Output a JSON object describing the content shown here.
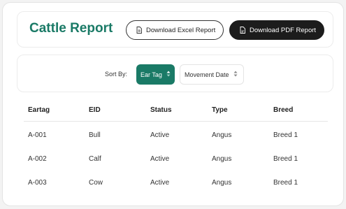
{
  "header": {
    "title": "Cattle Report",
    "excel_button": "Download Excel Report",
    "pdf_button": "Download PDF Report"
  },
  "sort": {
    "label": "Sort By:",
    "options": [
      {
        "label": "Ear Tag",
        "active": true
      },
      {
        "label": "Movement Date",
        "active": false
      }
    ]
  },
  "table": {
    "columns": [
      "Eartag",
      "EID",
      "Status",
      "Type",
      "Breed"
    ],
    "rows": [
      [
        "A-001",
        "Bull",
        "Active",
        "Angus",
        "Breed 1"
      ],
      [
        "A-002",
        "Calf",
        "Active",
        "Angus",
        "Breed 1"
      ],
      [
        "A-003",
        "Cow",
        "Active",
        "Angus",
        "Breed 1"
      ]
    ]
  },
  "colors": {
    "accent": "#1a7a66",
    "dark_button": "#1c1c1c"
  }
}
